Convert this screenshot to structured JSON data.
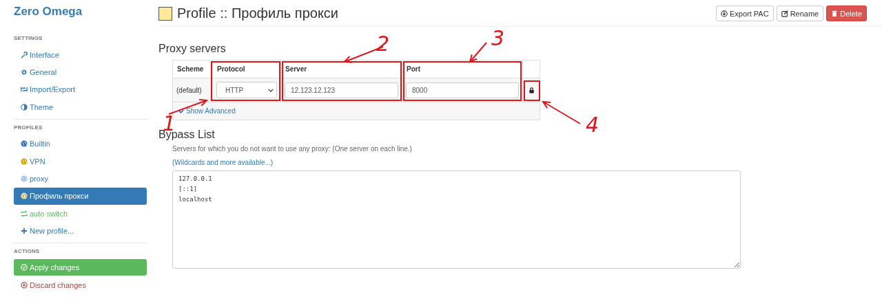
{
  "app_title": "Zero Omega",
  "sidebar": [
    {
      "heading": "SETTINGS",
      "items": [
        {
          "kind": "wrench",
          "label": "Interface",
          "selected": false
        },
        {
          "kind": "gear",
          "label": "General",
          "selected": false
        },
        {
          "kind": "transfer",
          "label": "Import/Export",
          "selected": false
        },
        {
          "kind": "contrast",
          "label": "Theme",
          "selected": false
        }
      ]
    },
    {
      "heading": "PROFILES",
      "items": [
        {
          "kind": "globe",
          "label": "Builtin",
          "selected": false,
          "color": "#2a6fb0"
        },
        {
          "kind": "globe",
          "label": "VPN",
          "selected": false,
          "color": "#d9a400"
        },
        {
          "kind": "globe",
          "label": "proxy",
          "selected": false,
          "color": "#99c2e8"
        },
        {
          "kind": "globe",
          "label": "Профиль прокси",
          "selected": true,
          "color": "#fde99a"
        },
        {
          "kind": "switch",
          "label": "auto switch",
          "selected": false,
          "color": "#5cb85c"
        },
        {
          "kind": "add",
          "label": "New profile...",
          "selected": false
        }
      ]
    },
    {
      "heading": "ACTIONS",
      "items": [
        {
          "kind": "apply",
          "label": "Apply changes"
        },
        {
          "kind": "discard",
          "label": "Discard changes"
        }
      ]
    }
  ],
  "header": {
    "color": "#fde99a",
    "title": "Profile :: Профиль прокси",
    "buttons": [
      {
        "kind": "export",
        "label": "Export PAC"
      },
      {
        "kind": "rename",
        "label": "Rename"
      },
      {
        "kind": "delete",
        "label": "Delete"
      }
    ]
  },
  "proxy_servers": {
    "title": "Proxy servers",
    "columns": [
      "Scheme",
      "Protocol",
      "Server",
      "Port"
    ],
    "row": {
      "scheme": "(default)",
      "protocol": "HTTP",
      "server": "12.123.12.123",
      "port": "8000"
    },
    "show_advanced": "Show Advanced"
  },
  "bypass": {
    "title": "Bypass List",
    "description": "Servers for which you do not want to use any proxy: (One server on each line.)",
    "link": "(Wildcards and more available...)",
    "value": "127.0.0.1\n[::1]\nlocalhost"
  },
  "annotations": [
    {
      "label": "1"
    },
    {
      "label": "2"
    },
    {
      "label": "3"
    },
    {
      "label": "4"
    }
  ]
}
